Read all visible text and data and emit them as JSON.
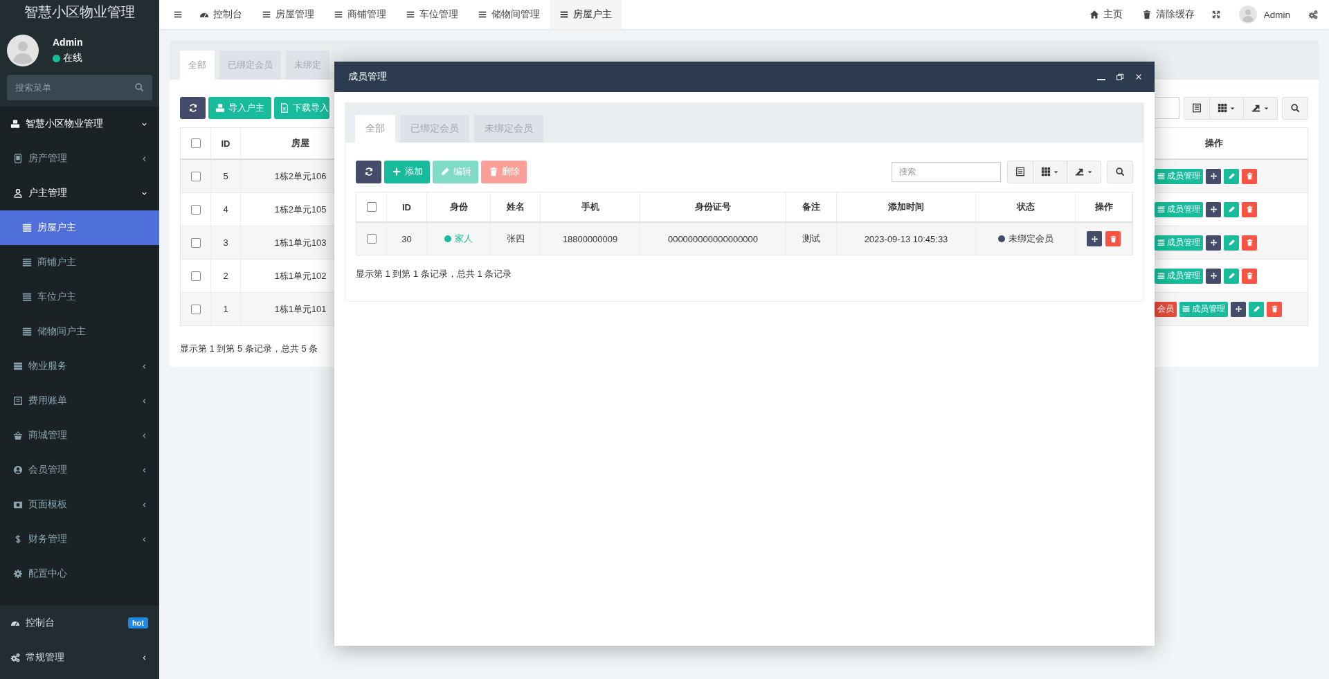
{
  "sidebar": {
    "title": "智慧小区物业管理",
    "user": {
      "name": "Admin",
      "status": "在线",
      "online": true
    },
    "search": {
      "placeholder": "搜索菜单"
    },
    "menu": [
      {
        "label": "智慧小区物业管理",
        "kind": "folder",
        "expanded": true,
        "children": [
          {
            "label": "房产管理",
            "kind": "folder",
            "expanded": false
          },
          {
            "label": "户主管理",
            "kind": "folder",
            "expanded": true,
            "children": [
              {
                "label": "房屋户主",
                "selected": true
              },
              {
                "label": "商铺户主",
                "selected": false
              },
              {
                "label": "车位户主",
                "selected": false
              },
              {
                "label": "储物间户主",
                "selected": false
              }
            ]
          },
          {
            "label": "物业服务",
            "kind": "folder",
            "expanded": false
          },
          {
            "label": "费用账单",
            "kind": "folder",
            "expanded": false
          },
          {
            "label": "商城管理",
            "kind": "folder",
            "expanded": false
          },
          {
            "label": "会员管理",
            "kind": "folder",
            "expanded": false
          },
          {
            "label": "页面模板",
            "kind": "folder",
            "expanded": false
          },
          {
            "label": "财务管理",
            "kind": "folder",
            "expanded": false
          },
          {
            "label": "配置中心",
            "kind": "page"
          }
        ]
      }
    ],
    "menu_extra": [
      {
        "label": "控制台",
        "kind": "page",
        "badge": "hot"
      },
      {
        "label": "常规管理",
        "kind": "folder",
        "expanded": false
      }
    ]
  },
  "topbar": {
    "tabs": [
      {
        "label": "控制台",
        "selected": false
      },
      {
        "label": "房屋管理",
        "selected": false
      },
      {
        "label": "商铺管理",
        "selected": false
      },
      {
        "label": "车位管理",
        "selected": false
      },
      {
        "label": "储物间管理",
        "selected": false
      },
      {
        "label": "房屋户主",
        "selected": true
      }
    ],
    "links": [
      {
        "label": "主页"
      },
      {
        "label": "清除缓存"
      }
    ],
    "user": "Admin"
  },
  "page": {
    "tabs": [
      {
        "label": "全部",
        "selected": true
      },
      {
        "label": "已绑定会员",
        "selected": false
      },
      {
        "label": "未绑定",
        "selected": false
      }
    ],
    "toolbar": [
      {
        "kind": "refresh"
      },
      {
        "kind": "import",
        "label": "导入户主"
      },
      {
        "kind": "download",
        "label": "下载导入"
      }
    ],
    "table": {
      "check_all": false,
      "columns": [
        "ID",
        "房屋"
      ],
      "action_column": "操作",
      "rows": [
        {
          "checked": false,
          "id": "5",
          "house": "1栋2单元106",
          "actions": [
            {
              "kind": "members",
              "label": "成员管理"
            },
            {
              "kind": "move"
            },
            {
              "kind": "edit"
            },
            {
              "kind": "delete"
            }
          ]
        },
        {
          "checked": false,
          "id": "4",
          "house": "1栋2单元105",
          "actions": [
            {
              "kind": "members",
              "label": "成员管理"
            },
            {
              "kind": "move"
            },
            {
              "kind": "edit"
            },
            {
              "kind": "delete"
            }
          ]
        },
        {
          "checked": false,
          "id": "3",
          "house": "1栋1单元103",
          "actions": [
            {
              "kind": "members",
              "label": "成员管理"
            },
            {
              "kind": "move"
            },
            {
              "kind": "edit"
            },
            {
              "kind": "delete"
            }
          ]
        },
        {
          "checked": false,
          "id": "2",
          "house": "1栋1单元102",
          "actions": [
            {
              "kind": "members",
              "label": "成员管理"
            },
            {
              "kind": "move"
            },
            {
              "kind": "edit"
            },
            {
              "kind": "delete"
            }
          ]
        },
        {
          "checked": false,
          "id": "1",
          "house": "1栋1单元101",
          "actions": [
            {
              "kind": "bind",
              "label": "会员"
            },
            {
              "kind": "members",
              "label": "成员管理"
            },
            {
              "kind": "move"
            },
            {
              "kind": "edit"
            },
            {
              "kind": "delete"
            }
          ]
        }
      ]
    },
    "footer": "显示第 1 到第 5 条记录，总共 5 条"
  },
  "modal": {
    "title": "成员管理",
    "tabs": [
      {
        "label": "全部",
        "selected": true
      },
      {
        "label": "已绑定会员",
        "selected": false
      },
      {
        "label": "未绑定会员",
        "selected": false
      }
    ],
    "toolbar": [
      {
        "kind": "refresh"
      },
      {
        "kind": "add",
        "label": "添加",
        "disabled": false
      },
      {
        "kind": "edit",
        "label": "编辑",
        "disabled": true
      },
      {
        "kind": "delete",
        "label": "删除",
        "disabled": true
      }
    ],
    "search": {
      "placeholder": "搜索"
    },
    "table": {
      "check_all": false,
      "columns": [
        "ID",
        "身份",
        "姓名",
        "手机",
        "身份证号",
        "备注",
        "添加时间",
        "状态",
        "操作"
      ],
      "rows": [
        {
          "checked": false,
          "id": "30",
          "role": {
            "label": "家人",
            "color": "#1abc9c"
          },
          "name": "张四",
          "phone": "18800000009",
          "id_number": "000000000000000000",
          "remark": "测试",
          "added": "2023-09-13 10:45:33",
          "status": {
            "label": "未绑定会员",
            "color": "#444c69"
          },
          "actions": [
            {
              "kind": "move"
            },
            {
              "kind": "delete"
            }
          ]
        }
      ]
    },
    "footer": "显示第 1 到第 1 条记录，总共 1 条记录"
  }
}
